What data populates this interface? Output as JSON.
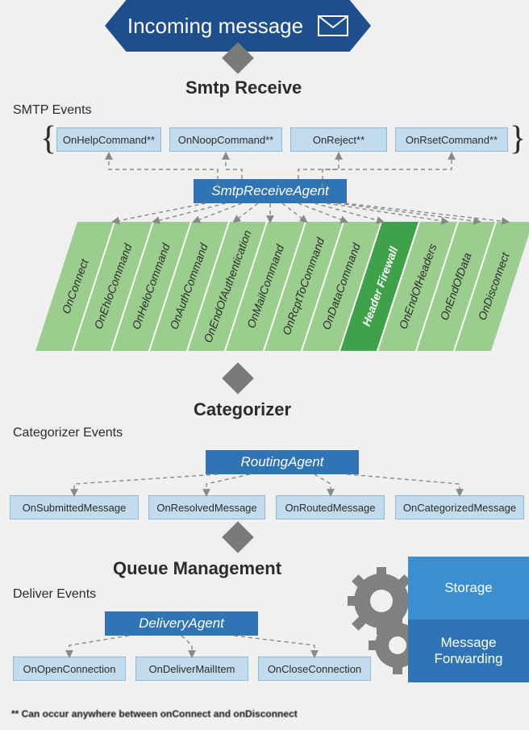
{
  "banner": {
    "text": "Incoming message"
  },
  "sections": {
    "smtp_receive": "Smtp Receive",
    "categorizer": "Categorizer",
    "queue_mgmt": "Queue Management"
  },
  "labels": {
    "smtp_events": "SMTP Events",
    "categorizer_events": "Categorizer Events",
    "deliver_events": "Deliver Events"
  },
  "agents": {
    "smtp": "SmtpReceiveAgent",
    "routing": "RoutingAgent",
    "delivery": "DeliveryAgent"
  },
  "smtp_top_events": [
    "OnHelpCommand**",
    "OnNoopCommand**",
    "OnReject**",
    "OnRsetCommand**"
  ],
  "smtp_band": [
    "OnConnect",
    "OnEhloCommand",
    "OnHeloCommand",
    "OnAuthCommand",
    "OnEndOfAuthentication",
    "OnMailCommand",
    "OnRcptToCommand",
    "OnDataCommand",
    "Header Firewall",
    "OnEndOfHeaders",
    "OnEndOfData",
    "OnDisconnect"
  ],
  "smtp_band_highlight_index": 8,
  "categorizer_events": [
    "OnSubmittedMessage",
    "OnResolvedMessage",
    "OnRoutedMessage",
    "OnCategorizedMessage"
  ],
  "delivery_events": [
    "OnOpenConnection",
    "OnDeliverMailItem",
    "OnCloseConnection"
  ],
  "side": {
    "storage": "Storage",
    "forwarding": "Message Forwarding"
  },
  "footnote": "** Can occur anywhere between onConnect and onDisconnect"
}
